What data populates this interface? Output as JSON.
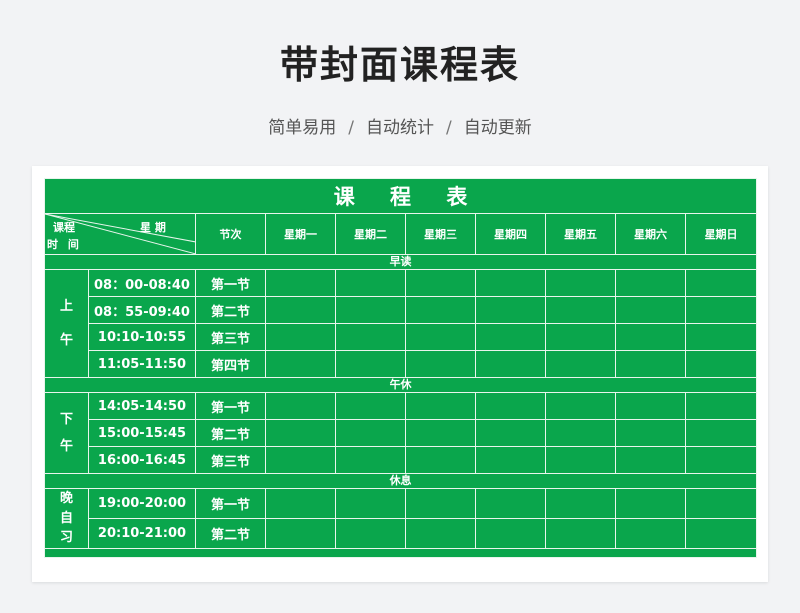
{
  "header": {
    "title": "带封面课程表",
    "subtitle": [
      "简单易用",
      "自动统计",
      "自动更新"
    ],
    "separator": "/"
  },
  "table": {
    "title": "课 程 表",
    "corner": {
      "week": "星 期",
      "course": "课程",
      "time": "时 间"
    },
    "section_header": "节次",
    "days": [
      "星期一",
      "星期二",
      "星期三",
      "星期四",
      "星期五",
      "星期六",
      "星期日"
    ],
    "sections": {
      "morning_reading": "早读",
      "noon_break": "午休",
      "rest": "休息"
    },
    "morning": {
      "label": [
        "上",
        "午"
      ],
      "slots": [
        {
          "time": "08：00-08:40",
          "period": "第一节"
        },
        {
          "time": "08：55-09:40",
          "period": "第二节"
        },
        {
          "time": "10:10-10:55",
          "period": "第三节"
        },
        {
          "time": "11:05-11:50",
          "period": "第四节"
        }
      ]
    },
    "afternoon": {
      "label": [
        "下",
        "午"
      ],
      "slots": [
        {
          "time": "14:05-14:50",
          "period": "第一节"
        },
        {
          "time": "15:00-15:45",
          "period": "第二节"
        },
        {
          "time": "16:00-16:45",
          "period": "第三节"
        }
      ]
    },
    "evening": {
      "label": [
        "晚",
        "自",
        "习"
      ],
      "slots": [
        {
          "time": "19:00-20:00",
          "period": "第一节"
        },
        {
          "time": "20:10-21:00",
          "period": "第二节"
        }
      ]
    }
  },
  "colors": {
    "table_green": "#0aa64c",
    "background": "#f2f3f5",
    "grid_line": "#e8f5ec"
  }
}
